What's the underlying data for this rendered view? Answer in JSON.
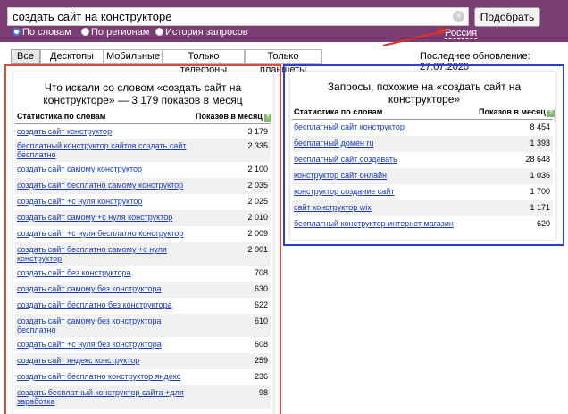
{
  "search": {
    "query": "создать сайт на конструкторе",
    "clear_icon": "×",
    "submit_label": "Подобрать"
  },
  "modes": [
    {
      "label": "По словам",
      "selected": true
    },
    {
      "label": "По регионам",
      "selected": false
    },
    {
      "label": "История запросов",
      "selected": false
    }
  ],
  "region": "Россия",
  "tabs": [
    "Все",
    "Десктопы",
    "Мобильные",
    "Только телефоны",
    "Только планшеты"
  ],
  "active_tab": "Все",
  "last_update": "Последнее обновление: 27.07.2020",
  "left_panel": {
    "title": "Что искали со словом «создать сайт на конструкторе» — 3 179 показов в месяц",
    "col_keyword": "Статистика по словам",
    "col_count": "Показов в месяц",
    "help_icon": "?",
    "rows": [
      {
        "keyword": "создать сайт конструктор",
        "count": "3 179"
      },
      {
        "keyword": "бесплатный конструктор сайтов создать сайт бесплатно",
        "count": "2 335"
      },
      {
        "keyword": "создать сайт самому конструктор",
        "count": "2 100"
      },
      {
        "keyword": "создать сайт бесплатно самому конструктор",
        "count": "2 035"
      },
      {
        "keyword": "создать сайт +с нуля конструктор",
        "count": "2 025"
      },
      {
        "keyword": "создать сайт самому +с нуля конструктор",
        "count": "2 010"
      },
      {
        "keyword": "создать сайт +с нуля бесплатно конструктор",
        "count": "2 009"
      },
      {
        "keyword": "создать сайт бесплатно самому +с нуля конструктор",
        "count": "2 001"
      },
      {
        "keyword": "создать сайт без конструктора",
        "count": "708"
      },
      {
        "keyword": "создать сайт самому без конструктора",
        "count": "630"
      },
      {
        "keyword": "создать сайт бесплатно без конструктора",
        "count": "622"
      },
      {
        "keyword": "создать сайт самому без конструктора бесплатно",
        "count": "610"
      },
      {
        "keyword": "создать сайт +с нуля без конструктора",
        "count": "608"
      },
      {
        "keyword": "создать сайт яндекс конструктор",
        "count": "259"
      },
      {
        "keyword": "создать сайт бесплатно конструктор яндекс",
        "count": "236"
      },
      {
        "keyword": "создать бесплатный конструктор сайта +для заработка",
        "count": "98"
      }
    ]
  },
  "right_panel": {
    "title": "Запросы, похожие на «создать сайт на конструкторе»",
    "col_keyword": "Статистика по словам",
    "col_count": "Показов в месяц",
    "help_icon": "?",
    "rows": [
      {
        "keyword": "бесплатный сайт конструктор",
        "count": "8 454"
      },
      {
        "keyword": "бесплатный домен ru",
        "count": "1 393"
      },
      {
        "keyword": "бесплатный сайт создавать",
        "count": "28 648"
      },
      {
        "keyword": "конструктор сайт онлайн",
        "count": "1 036"
      },
      {
        "keyword": "конструктор создание сайт",
        "count": "1 700"
      },
      {
        "keyword": "сайт конструктор wix",
        "count": "1 171"
      },
      {
        "keyword": "бесплатный конструктор интернет магазин",
        "count": "620"
      }
    ]
  },
  "colors": {
    "header_bg": "#7a3d74",
    "link": "#1a3cb5",
    "left_frame": "#e24a3b",
    "right_frame": "#2b3fd6",
    "annotation_arrow": "#e03024"
  }
}
